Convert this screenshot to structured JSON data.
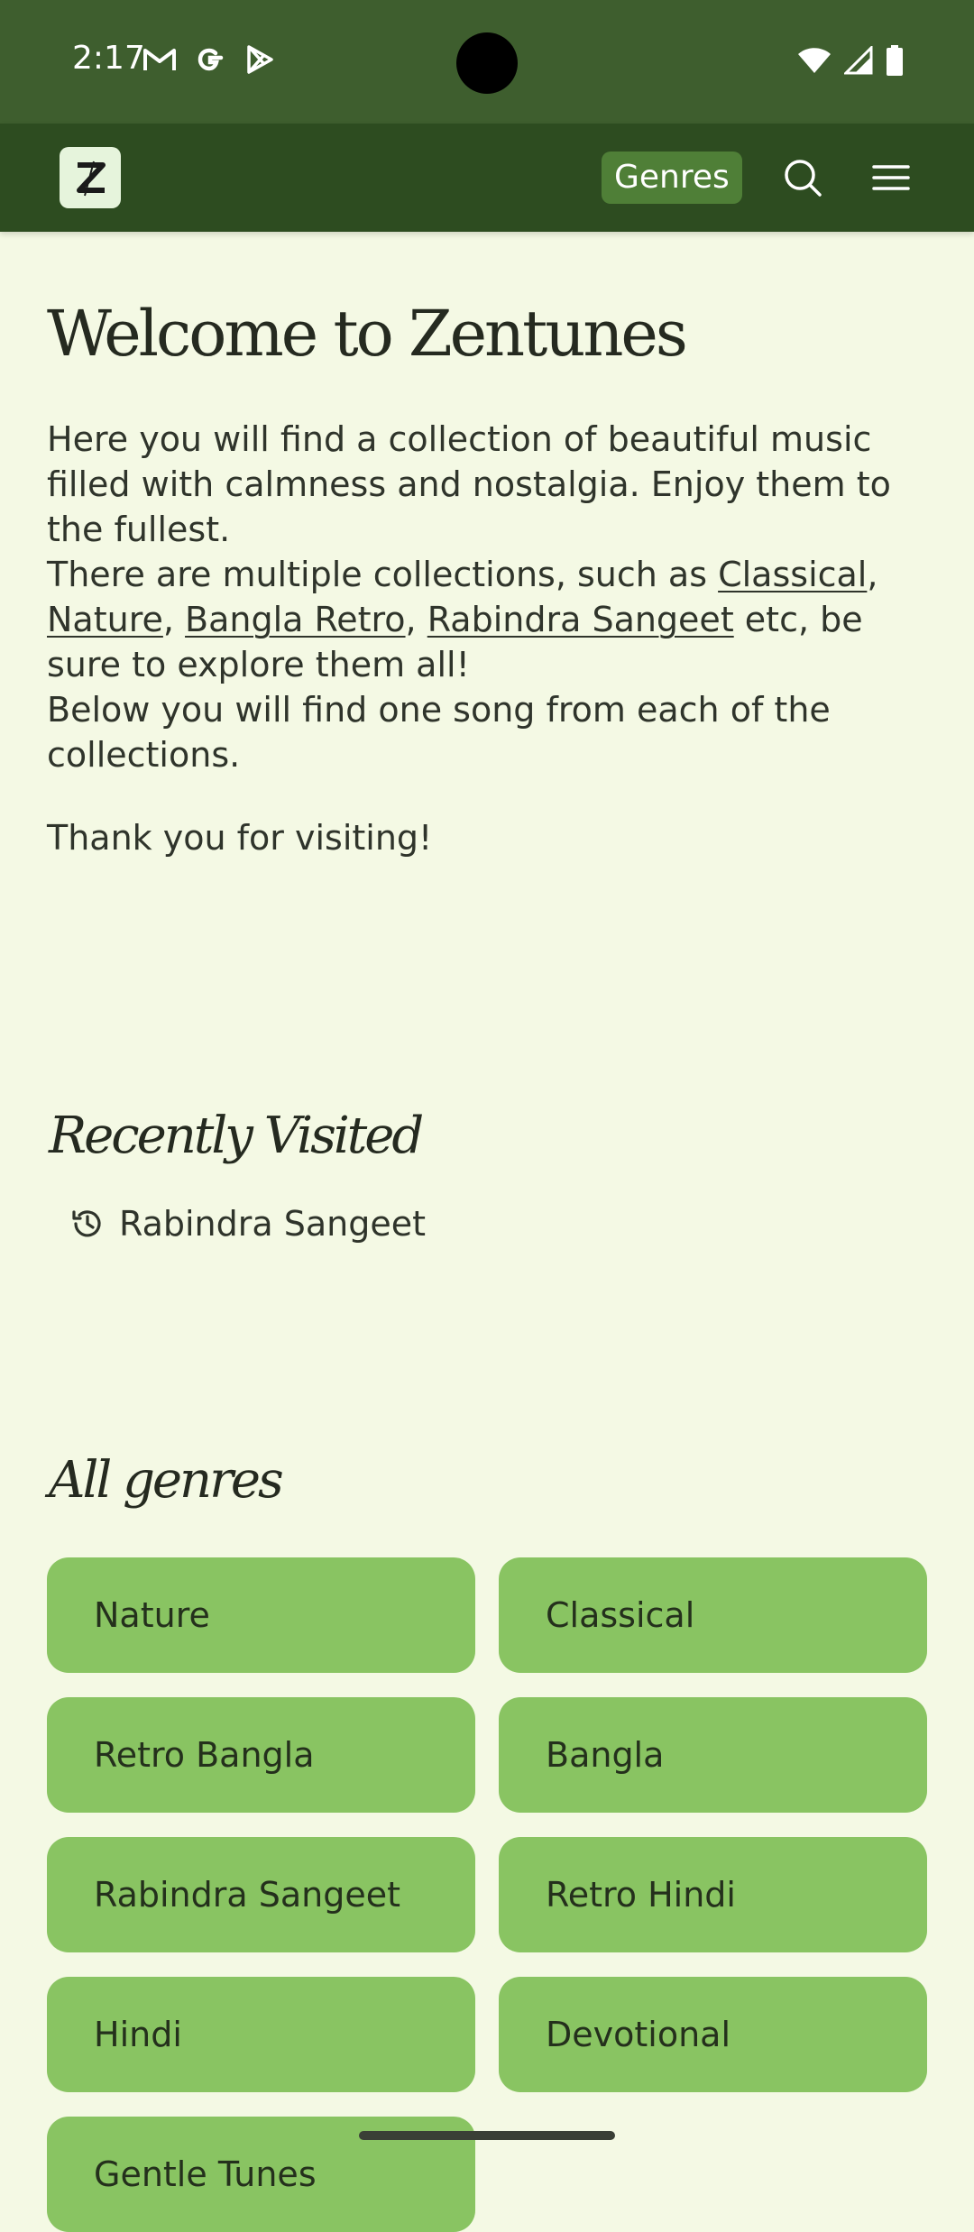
{
  "status_bar": {
    "time": "2:17",
    "left_icons": [
      "gmail-icon",
      "google-icon",
      "play-store-icon"
    ],
    "right_icons": [
      "wifi-icon",
      "signal-icon",
      "battery-icon"
    ]
  },
  "app_bar": {
    "logo_letter": "Z",
    "genres_label": "Genres",
    "icons": [
      "search-icon",
      "menu-icon"
    ]
  },
  "home": {
    "title": "Welcome to Zentunes",
    "intro_line1": "Here you will find a collection of beautiful music filled with calmness and nostalgia. Enjoy them to the fullest.",
    "intro_line2_prefix": "There are multiple collections, such as ",
    "collection_links": [
      "Classical",
      "Nature",
      "Bangla Retro",
      "Rabindra Sangeet"
    ],
    "intro_line2_suffix": " etc, be sure to explore them all!",
    "intro_line3": "Below you will find one song from each of the collections.",
    "thanks": "Thank you for visiting!"
  },
  "recently_visited": {
    "title": "Recently Visited",
    "items": [
      "Rabindra Sangeet"
    ]
  },
  "all_genres": {
    "title": "All genres",
    "items": [
      "Nature",
      "Classical",
      "Retro Bangla",
      "Bangla",
      "Rabindra Sangeet",
      "Retro Hindi",
      "Hindi",
      "Devotional",
      "Gentle Tunes"
    ]
  },
  "colors": {
    "status_bar": "#3e5e2e",
    "app_bar": "#2d4c20",
    "background": "#f4f9e4",
    "genre_button": "#89c462",
    "genres_chip": "#4f7f37"
  }
}
